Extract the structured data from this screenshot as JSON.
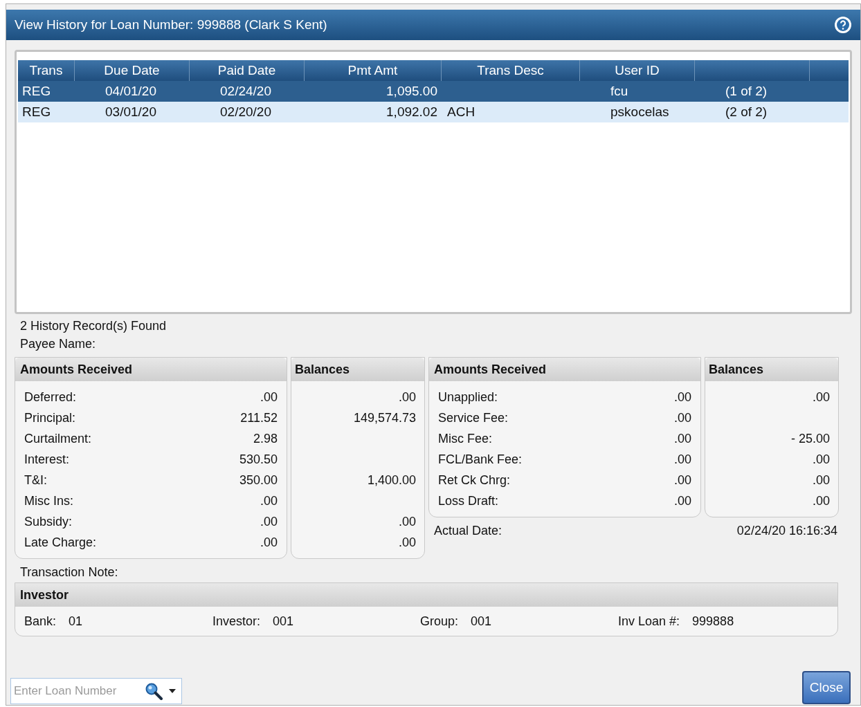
{
  "window": {
    "title": "View History for Loan Number: 999888 (Clark S Kent)"
  },
  "table": {
    "columns": [
      "Trans",
      "Due Date",
      "Paid Date",
      "Pmt Amt",
      "Trans Desc",
      "User ID"
    ],
    "rows": [
      {
        "selected": true,
        "cells": [
          "REG",
          "04/01/20",
          "02/24/20",
          "1,095.00",
          "",
          "fcu",
          "(1 of 2)"
        ]
      },
      {
        "selected": false,
        "cells": [
          "REG",
          "03/01/20",
          "02/20/20",
          "1,092.02",
          "ACH",
          "pskocelas",
          "(2 of 2)"
        ]
      }
    ]
  },
  "records_found": "2 History Record(s) Found",
  "payee_label": "Payee Name:",
  "groups": [
    {
      "amounts_title": "Amounts Received",
      "balances_title": "Balances",
      "rows": [
        {
          "label": "Deferred:",
          "amount": ".00",
          "balance": ".00"
        },
        {
          "label": "Principal:",
          "amount": "211.52",
          "balance": "149,574.73"
        },
        {
          "label": "Curtailment:",
          "amount": "2.98"
        },
        {
          "label": "Interest:",
          "amount": "530.50"
        },
        {
          "label": "T&I:",
          "amount": "350.00",
          "balance": "1,400.00"
        },
        {
          "label": "Misc Ins:",
          "amount": ".00"
        },
        {
          "label": "Subsidy:",
          "amount": ".00",
          "balance": ".00"
        },
        {
          "label": "Late Charge:",
          "amount": ".00",
          "balance": ".00"
        }
      ]
    },
    {
      "amounts_title": "Amounts Received",
      "balances_title": "Balances",
      "rows": [
        {
          "label": "Unapplied:",
          "amount": ".00",
          "balance": ".00"
        },
        {
          "label": "Service Fee:",
          "amount": ".00"
        },
        {
          "label": "Misc Fee:",
          "amount": ".00",
          "balance": "- 25.00"
        },
        {
          "label": "FCL/Bank Fee:",
          "amount": ".00",
          "balance": ".00"
        },
        {
          "label": "Ret Ck Chrg:",
          "amount": ".00",
          "balance": ".00"
        },
        {
          "label": "Loss Draft:",
          "amount": ".00",
          "balance": ".00"
        }
      ],
      "footer": {
        "label": "Actual Date:",
        "value": "02/24/20 16:16:34"
      }
    }
  ],
  "transaction_note_label": "Transaction Note:",
  "investor": {
    "title": "Investor",
    "fields": [
      {
        "label": "Bank:",
        "value": "01"
      },
      {
        "label": "Investor:",
        "value": "001"
      },
      {
        "label": "Group:",
        "value": "001"
      },
      {
        "label": "Inv Loan #:",
        "value": "999888"
      }
    ]
  },
  "loan_search": {
    "placeholder": "Enter Loan Number"
  },
  "buttons": [
    "Close"
  ]
}
